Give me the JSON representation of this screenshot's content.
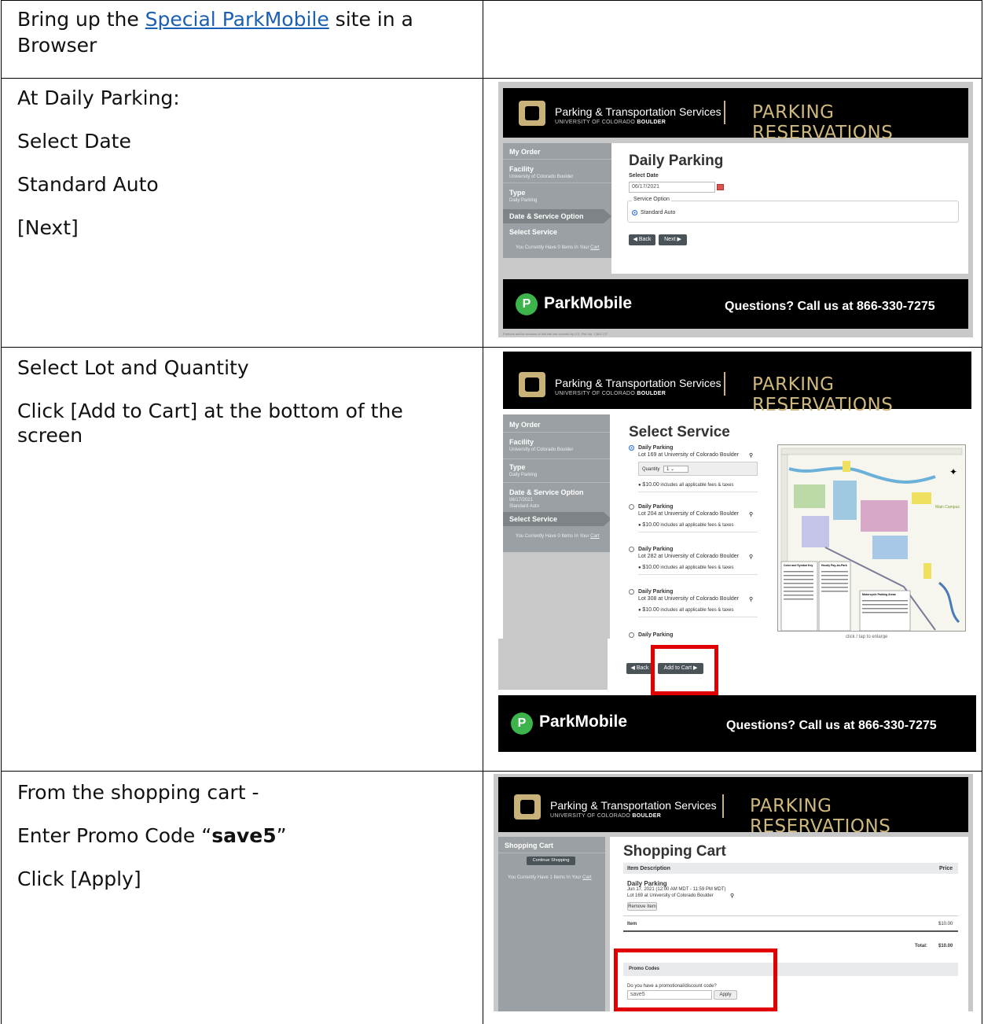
{
  "rows": [
    {
      "lines": [
        {
          "pre": "Bring up the ",
          "link": "Special ParkMobile",
          "post": " site in a"
        },
        {
          "text": "Browser"
        }
      ]
    },
    {
      "lines": [
        {
          "text": "At Daily Parking:"
        },
        {
          "text": "Select Date"
        },
        {
          "text": "Standard Auto"
        },
        {
          "text": "[Next]"
        }
      ]
    },
    {
      "lines": [
        {
          "text": "Select Lot and Quantity"
        },
        {
          "text": "Click [Add to Cart] at the bottom of the"
        },
        {
          "text": "screen"
        }
      ]
    },
    {
      "lines": [
        {
          "text": "From the shopping cart -"
        },
        {
          "pre": "Enter Promo Code “",
          "bold": "save5",
          "post": "”"
        },
        {
          "text": "Click [Apply]"
        }
      ]
    }
  ],
  "header": {
    "org": "Parking & Transportation Services",
    "univ": "UNIVERSITY OF COLORADO ",
    "univ_bold": "BOULDER",
    "title": "PARKING RESERVATIONS"
  },
  "footer": {
    "brand": "ParkMobile",
    "logo_letter": "P",
    "phone": "Questions? Call us at 866-330-7275",
    "fineprint": "Portions and/or versions of this site are covered by U.S. Pat. No. 7,801,727"
  },
  "shot1": {
    "side": {
      "my_order": "My Order",
      "facility": "Facility",
      "facility_val": "University of Colorado Boulder",
      "type": "Type",
      "type_val": "Daily Parking",
      "date_service": "Date & Service Option",
      "select_service": "Select Service",
      "cart_pre": "You Currently Have 0 Items In Your ",
      "cart_link": "Cart"
    },
    "title": "Daily Parking",
    "select_date": "Select Date",
    "date_value": "06/17/2021",
    "service_option": "Service Option",
    "standard_auto": "Standard Auto",
    "back": "◀ Back",
    "next": "Next ▶"
  },
  "shot2": {
    "side": {
      "my_order": "My Order",
      "facility": "Facility",
      "facility_val": "University of Colorado Boulder",
      "type": "Type",
      "type_val": "Daily Parking",
      "date_service": "Date & Service Option",
      "date_val": "06/17/2021",
      "service_val": "Standard Auto",
      "select_service": "Select Service",
      "cart_pre": "You Currently Have 0 Items In Your ",
      "cart_link": "Cart"
    },
    "title": "Select Service",
    "services": [
      {
        "name": "Daily Parking",
        "lot": "Lot 169 at University of Colorado Boulder",
        "price": "$10.00",
        "note": "includes all applicable fees & taxes"
      },
      {
        "name": "Daily Parking",
        "lot": "Lot 204 at University of Colorado Boulder",
        "price": "$10.00",
        "note": "includes all applicable fees & taxes"
      },
      {
        "name": "Daily Parking",
        "lot": "Lot 282 at University of Colorado Boulder",
        "price": "$10.00",
        "note": "includes all applicable fees & taxes"
      },
      {
        "name": "Daily Parking",
        "lot": "Lot 308 at University of Colorado Boulder",
        "price": "$10.00",
        "note": "includes all applicable fees & taxes"
      },
      {
        "name": "Daily Parking"
      }
    ],
    "quantity_label": "Quantity",
    "quantity_value": "1",
    "map_caption": "click / tap to enlarge",
    "map_legend1": "Color and Symbol Key",
    "map_legend2": "Hourly Pay-As-Park",
    "map_legend3": "Motorcycle Parking Areas",
    "map_campus": "Main Campus",
    "back": "◀ Back",
    "add_to_cart": "Add to Cart ▶"
  },
  "shot3": {
    "side": {
      "shopping_cart": "Shopping Cart",
      "continue": "Continue Shopping",
      "cart_pre": "You Currently Have 1 Items In Your ",
      "cart_link": "Cart"
    },
    "title": "Shopping Cart",
    "col_desc": "Item Description",
    "col_price": "Price",
    "item_name": "Daily Parking",
    "item_date": "Jun 17, 2021 (12:00 AM MDT - 11:59 PM MDT)",
    "item_lot": "Lot 169 at University of Colorado Boulder",
    "remove": "Remove Item",
    "item_label": "Item",
    "item_price": "$10.00",
    "total_label": "Total:",
    "total_value": "$10.00",
    "promo_header": "Promo Codes",
    "promo_question": "Do you have a promotional/discount code?",
    "promo_value": "save5",
    "apply": "Apply"
  },
  "colors": {
    "cu_gold": "#cfb87c",
    "parkmobile_green": "#3cb44b",
    "highlight_red": "#e00000",
    "link_blue": "#1a5fb4"
  }
}
